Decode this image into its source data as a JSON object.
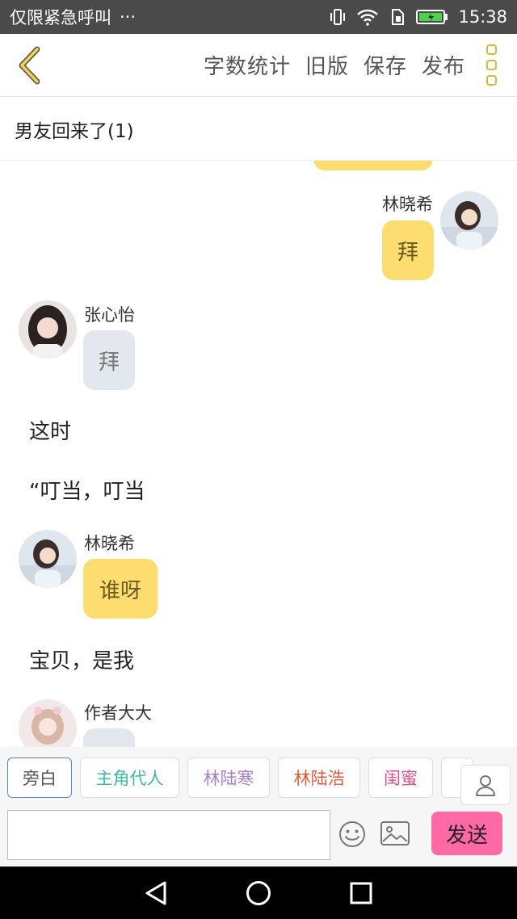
{
  "status_bar": {
    "carrier": "仅限紧急呼叫",
    "more": "···",
    "time": "15:38"
  },
  "toolbar": {
    "actions": [
      "字数统计",
      "旧版",
      "保存",
      "发布"
    ]
  },
  "chapter": {
    "title": "男友回来了(1)"
  },
  "chat": {
    "messages": [
      {
        "type": "bubble",
        "side": "right",
        "name": "林晓希",
        "text": "拜",
        "color": "yellow"
      },
      {
        "type": "bubble",
        "side": "left",
        "name": "张心怡",
        "text": "拜",
        "color": "grey"
      },
      {
        "type": "narration",
        "text": "这时"
      },
      {
        "type": "narration",
        "text": "“叮当，叮当"
      },
      {
        "type": "bubble",
        "side": "left",
        "name": "林晓希",
        "text": "谁呀",
        "color": "yellow"
      },
      {
        "type": "narration",
        "text": "宝贝，是我"
      },
      {
        "type": "bubble",
        "side": "left",
        "name": "作者大大",
        "text": "",
        "color": "grey"
      }
    ]
  },
  "roles": [
    {
      "label": "旁白",
      "color": "#555555",
      "selected": true
    },
    {
      "label": "主角代人",
      "color": "#3fb7a8"
    },
    {
      "label": "林陆寒",
      "color": "#a77fd1"
    },
    {
      "label": "林陆浩",
      "color": "#e05a3c"
    },
    {
      "label": "闺蜜",
      "color": "#e0508a"
    }
  ],
  "input": {
    "placeholder": "",
    "value": "",
    "send_label": "发送"
  },
  "colors": {
    "accent_yellow": "#fddd6f",
    "bubble_grey": "#e3e8ef",
    "send_pink": "#ff6aa6"
  }
}
